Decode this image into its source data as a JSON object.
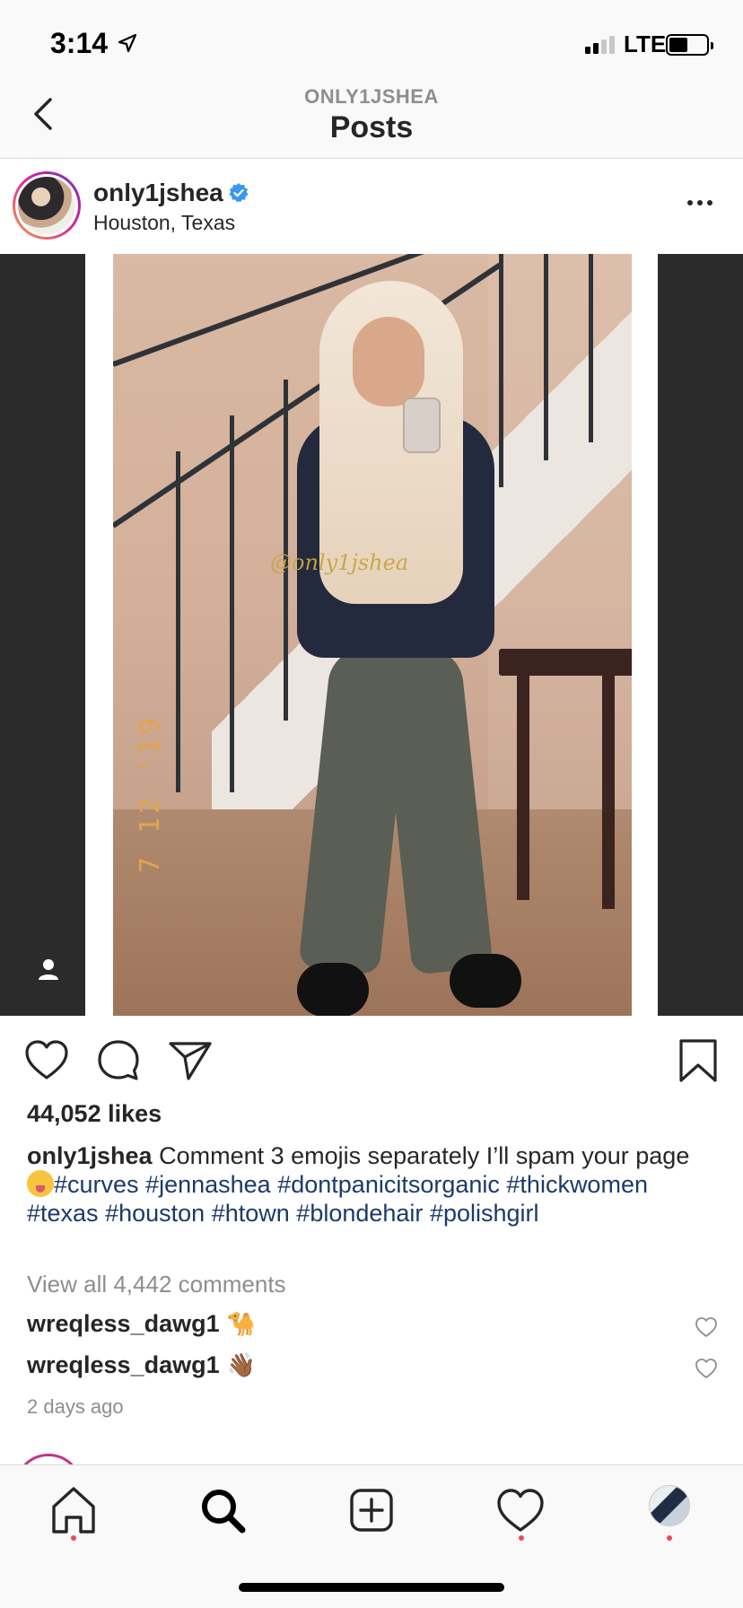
{
  "status_bar": {
    "time": "3:14",
    "network": "LTE"
  },
  "header": {
    "subtitle": "ONLY1JSHEA",
    "title": "Posts"
  },
  "post": {
    "username": "only1jshea",
    "location": "Houston, Texas",
    "image": {
      "watermark": "@only1jshea",
      "date_stamp": "7 12 '19"
    },
    "likes": "44,052 likes",
    "caption": {
      "username": "only1jshea",
      "text_1": "Comment 3 emojis separately I’ll spam your page",
      "hashtags": [
        "#curves",
        "#jennashea",
        "#dontpanicitsorganic",
        "#thickwomen",
        "#texas",
        "#houston",
        "#htown",
        "#blondehair",
        "#polishgirl"
      ]
    },
    "view_all_comments": "View all 4,442 comments",
    "comments": [
      {
        "username": "wreqless_dawg1",
        "emoji": "🐪"
      },
      {
        "username": "wreqless_dawg1",
        "emoji": "👋🏾"
      }
    ],
    "timestamp": "2 days ago"
  },
  "colors": {
    "hashtag": "#1c3a6b",
    "verified": "#3897f0",
    "notification_dot": "#ed4956",
    "muted_text": "#8e8e8e"
  },
  "icons": {
    "nav": "chevron-left-icon",
    "actions": [
      "heart-icon",
      "comment-icon",
      "send-icon",
      "bookmark-icon"
    ],
    "tabs": [
      "home-icon",
      "search-icon",
      "add-post-icon",
      "activity-heart-icon",
      "profile-avatar"
    ]
  }
}
